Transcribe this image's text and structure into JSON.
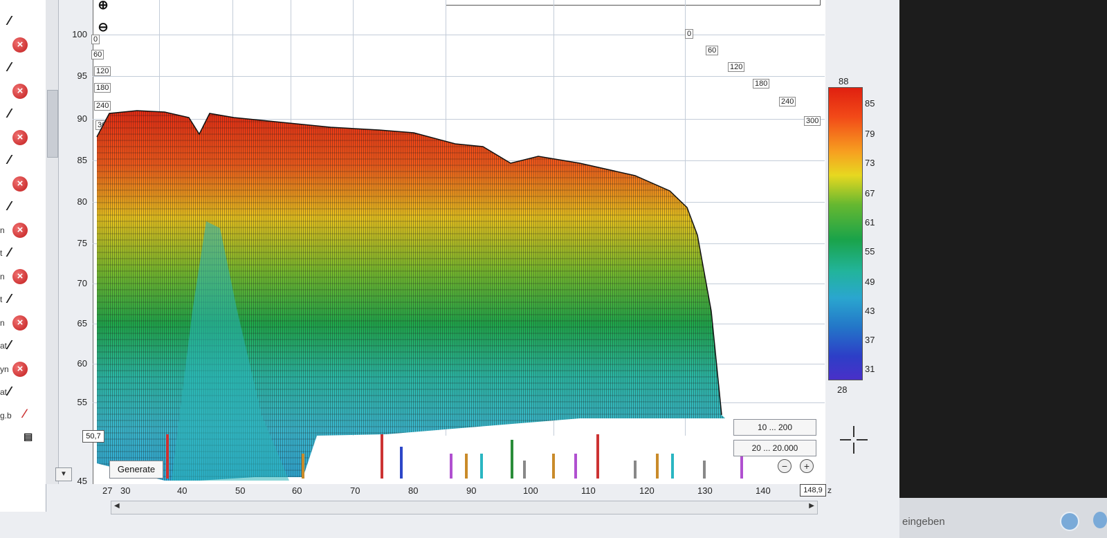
{
  "toolbar": {
    "generate_label": "Generate",
    "zoom_in_icon": "zoom-in-icon",
    "zoom_out_icon": "zoom-out-icon"
  },
  "left_panel": {
    "rows": [
      {
        "stub": "",
        "icon": "eq-icon"
      },
      {
        "stub": "",
        "icon": "remove-icon"
      },
      {
        "stub": "",
        "icon": "eq-icon"
      },
      {
        "stub": "",
        "icon": "remove-icon"
      },
      {
        "stub": "",
        "icon": "eq-icon"
      },
      {
        "stub": "",
        "icon": "remove-icon"
      },
      {
        "stub": "",
        "icon": "eq-icon"
      },
      {
        "stub": "",
        "icon": "remove-icon"
      },
      {
        "stub": "",
        "icon": "eq-icon"
      },
      {
        "stub": "n",
        "icon": "remove-icon"
      },
      {
        "stub": "t",
        "icon": "eq-icon"
      },
      {
        "stub": "n",
        "icon": "remove-icon"
      },
      {
        "stub": "t",
        "icon": "eq-icon"
      },
      {
        "stub": "n",
        "icon": "remove-icon"
      },
      {
        "stub": "at",
        "icon": "eq-icon"
      },
      {
        "stub": "yn",
        "icon": "remove-icon"
      },
      {
        "stub": "at",
        "icon": "eq-icon"
      },
      {
        "stub": "g.b",
        "icon": "pen-icon"
      },
      {
        "stub": "",
        "icon": "doc-icon"
      }
    ]
  },
  "y_axis": [
    "100",
    "95",
    "90",
    "85",
    "80",
    "75",
    "70",
    "65",
    "60",
    "55",
    "45"
  ],
  "x_axis": [
    "27",
    "30",
    "40",
    "50",
    "60",
    "70",
    "80",
    "90",
    "100",
    "110",
    "120",
    "130",
    "140"
  ],
  "time_ticks_left": [
    "0",
    "60",
    "120",
    "180",
    "240",
    "300"
  ],
  "time_ticks_right": [
    "0",
    "60",
    "120",
    "180",
    "240",
    "300"
  ],
  "cursor_value": "50,7",
  "x_end_value": "148,9",
  "x_unit": "z",
  "range_boxes": {
    "time_range": "10 ... 200",
    "freq_range": "20 ... 20.000"
  },
  "color_scale": {
    "top": "88",
    "bottom": "28",
    "labels": [
      "85",
      "79",
      "73",
      "67",
      "61",
      "55",
      "49",
      "43",
      "37",
      "31"
    ]
  },
  "taskbar": {
    "search_text": "eingeben"
  },
  "colors": {
    "accent_red": "#e02010",
    "accent_green": "#1aa34a",
    "accent_blue": "#2376c8"
  }
}
